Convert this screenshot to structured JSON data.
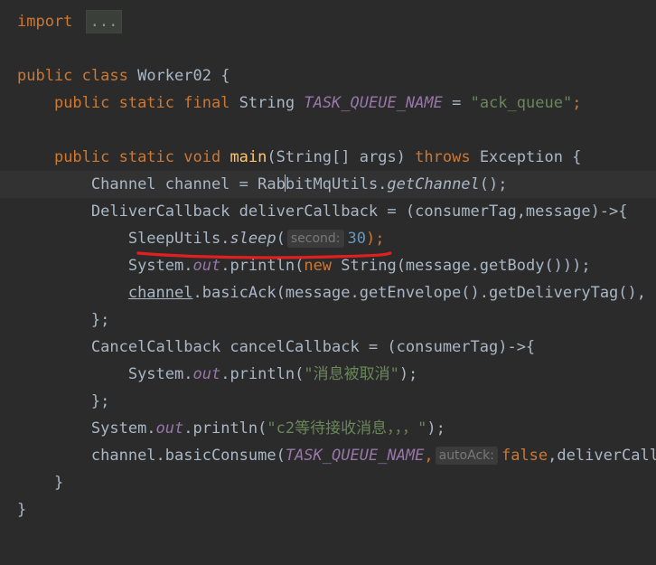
{
  "lines": [
    {
      "import_kw": "import",
      "collapsed": "..."
    },
    {},
    {
      "kw": "public class",
      "name": "Worker02",
      "brace": " {"
    },
    {
      "kw": "public static final",
      "type": "String",
      "const": "TASK_QUEUE_NAME",
      "eq": " = ",
      "str": "\"ack_queue\"",
      "semi": ";"
    },
    {},
    {
      "kw": "public static void",
      "fn": "main",
      "params": "(String[] args) ",
      "throws": "throws",
      "rest": " Exception {"
    },
    {
      "a": "Channel channel = Rab",
      "b": "bitMqUtils.",
      "call": "getChannel",
      "end": "();"
    },
    {
      "text": "DeliverCallback deliverCallback = (consumerTag,message)->{"
    },
    {
      "cls": "SleepUtils.",
      "call": "sleep",
      "open": "(",
      "hint": "second:",
      "num": "30",
      "close": ");"
    },
    {
      "a": "System.",
      "field": "out",
      "b": ".println(",
      "kw": "new",
      "c": " String(message.getBody()));"
    },
    {
      "var": "channel",
      "text": ".basicAck(message.getEnvelope().getDeliveryTag(), false);"
    },
    {
      "text": "};"
    },
    {
      "text": "CancelCallback cancelCallback = (consumerTag)->{"
    },
    {
      "a": "System.",
      "field": "out",
      "b": ".println(",
      "str": "\"消息被取消\"",
      "end": ");"
    },
    {
      "text": "};"
    },
    {
      "a": "System.",
      "field": "out",
      "b": ".println(",
      "str": "\"c2等待接收消息，，，\"",
      "end": ");"
    },
    {
      "a": "channel.basicConsume(",
      "const": "TASK_QUEUE_NAME",
      "comma": ",",
      "hint": "autoAck:",
      "kw": "false",
      "rest": ",deliverCallback, cancelCallback);"
    },
    {
      "text": "}"
    },
    {
      "text": "}"
    }
  ],
  "colors": {
    "background": "#2b2b2b",
    "keyword": "#cc7832",
    "string": "#6a8759",
    "number": "#6897bb",
    "constant": "#9876aa",
    "method": "#ffc66d",
    "text": "#a9b7c6",
    "annotation_mark": "#e02020"
  }
}
